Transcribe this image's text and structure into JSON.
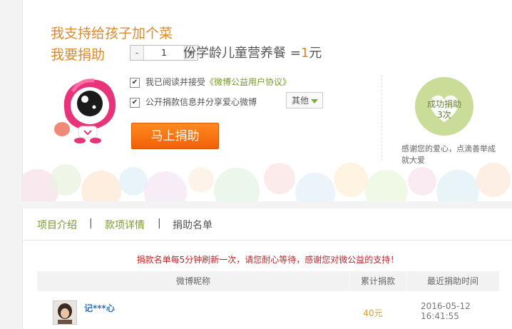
{
  "hero": {
    "line1": "我支持给孩子加个菜",
    "line2": "我要捐助",
    "stepper": {
      "minus": "-",
      "value": "1",
      "plus": "+"
    },
    "unit_prefix": "份学龄儿童营养餐 =",
    "unit_amount": "1",
    "unit_suffix": "元",
    "agree_prefix": "我已阅读并接受",
    "agree_link": "《微博公益用户协议》",
    "share_label": "公开捐款信息并分享爱心微博",
    "share_select": "其他",
    "donate_button": "马上捐助"
  },
  "success": {
    "line1": "成功捐助",
    "line2": "3次",
    "thanks": "感谢您的爱心，点滴善举成就大爱"
  },
  "tabs": [
    "项目介绍",
    "款项详情",
    "捐助名单"
  ],
  "tab_separator": "|",
  "notice": "捐款名单每5分钟刷新一次，请您耐心等待，感谢您对微公益的支持！",
  "table": {
    "headers": [
      "微博昵称",
      "累计捐款",
      "最近捐助时间"
    ],
    "rows": [
      {
        "nickname": "记***心",
        "amount": "40元",
        "date": "2016-05-12",
        "time": "16:41:55"
      }
    ]
  },
  "colors": {
    "accent": "#e0892a",
    "link_green": "#7a9a2a",
    "button_orange": "#f0600a",
    "notice_red": "#b52a2a",
    "heart_green": "#c9dc98"
  }
}
